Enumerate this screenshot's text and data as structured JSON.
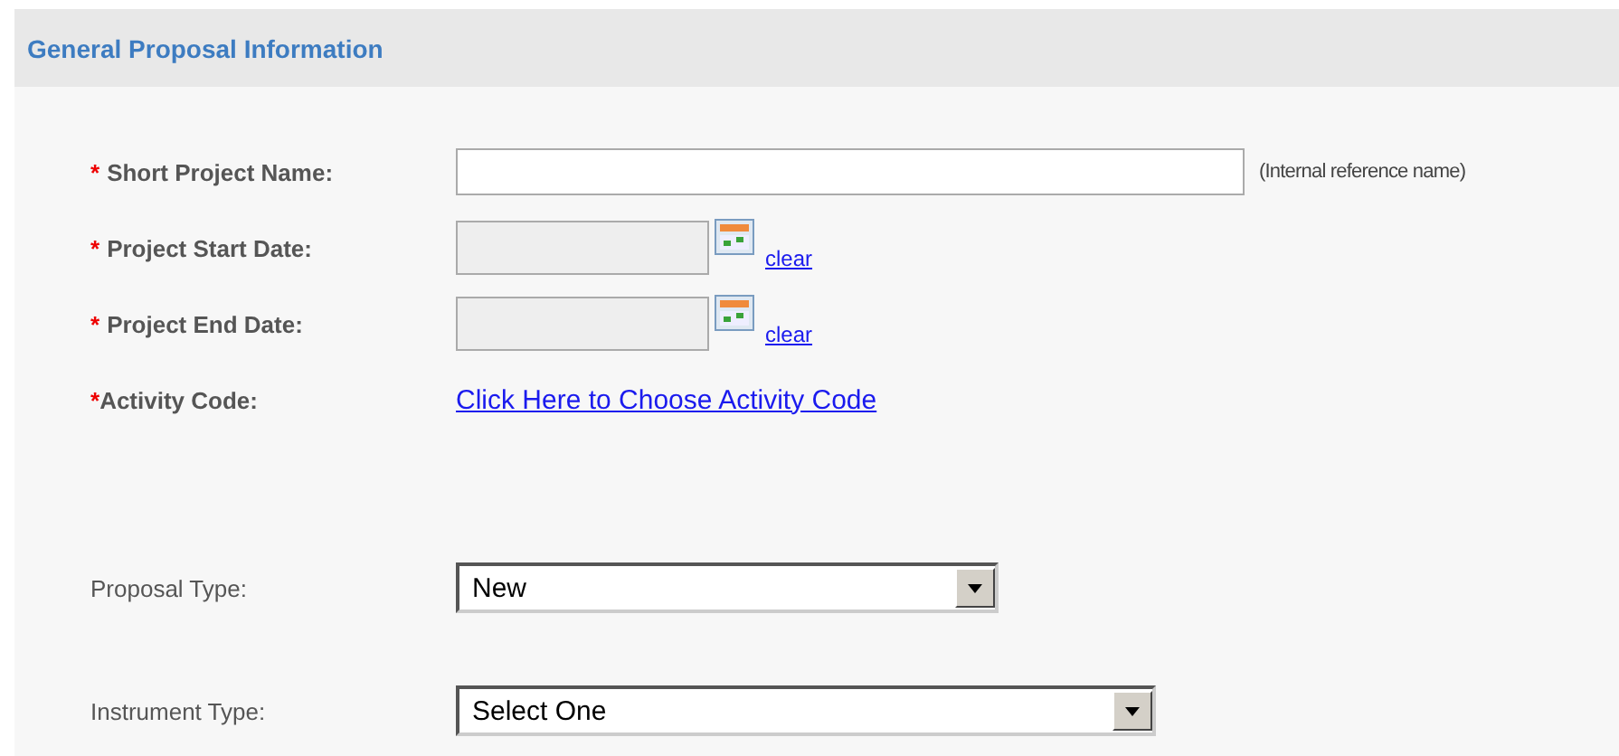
{
  "section": {
    "title": "General Proposal Information"
  },
  "rows": [
    {
      "kind": "text",
      "required_mark": "*",
      "label": "Short Project Name:",
      "value": "",
      "hint": "(Internal reference name)"
    },
    {
      "kind": "date",
      "required_mark": "*",
      "label": "Project Start Date:",
      "value": "",
      "action": "clear"
    },
    {
      "kind": "date",
      "required_mark": "*",
      "label": "Project End Date:",
      "value": "",
      "action": "clear"
    },
    {
      "kind": "link",
      "required_mark": "*",
      "label": "Activity Code:",
      "link": "Click Here to Choose Activity Code"
    },
    {
      "kind": "select",
      "label": "Proposal Type:",
      "value": "New"
    },
    {
      "kind": "select",
      "label": "Instrument Type:",
      "value": "Select One"
    }
  ]
}
